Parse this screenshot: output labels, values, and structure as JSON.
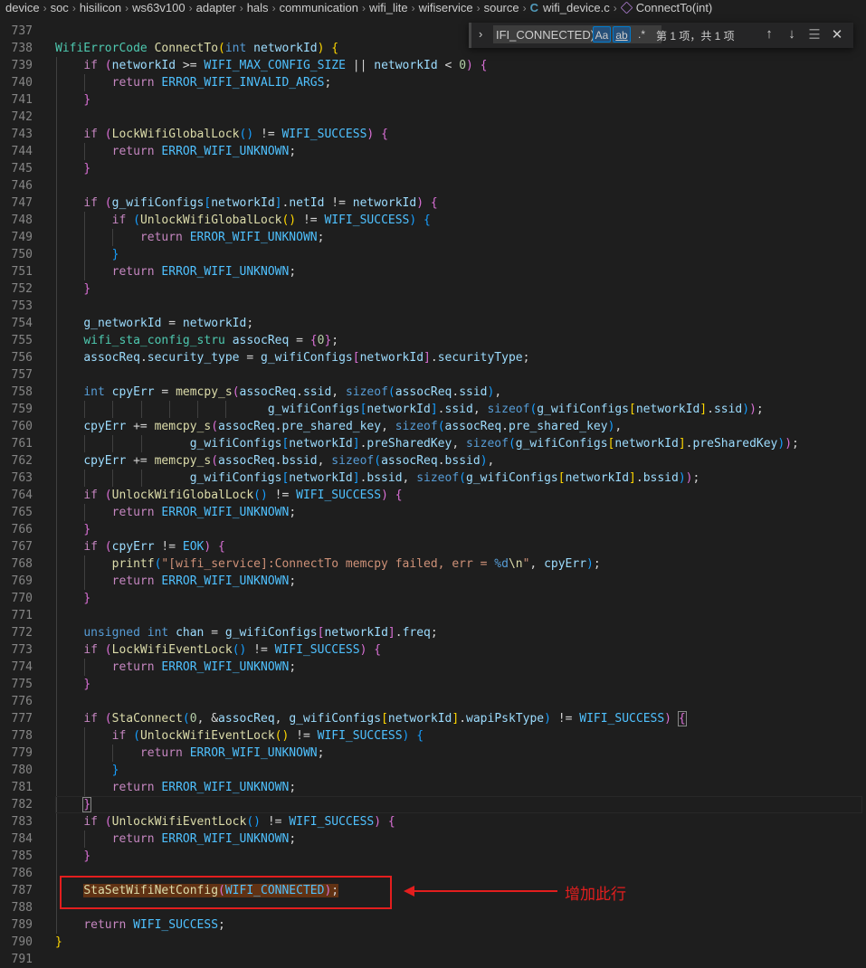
{
  "breadcrumb": {
    "items": [
      "device",
      "soc",
      "hisilicon",
      "ws63v100",
      "adapter",
      "hals",
      "communication",
      "wifi_lite",
      "wifiservice",
      "source"
    ],
    "file": "wifi_device.c",
    "symbol": "ConnectTo(int)"
  },
  "find_widget": {
    "query": "IFI_CONNECTED);",
    "match_case_label": "Aa",
    "whole_word_label": "ab",
    "regex_label": ".*",
    "result_count": "第 1 项，共 1 项"
  },
  "annotation": {
    "text": "增加此行"
  },
  "colors": {
    "annotation": "#e31e1e",
    "background": "#1e1e1e"
  },
  "lines": [
    {
      "n": "737",
      "html": ""
    },
    {
      "n": "738",
      "html": "<span class='ty'>WifiErrorCode</span> <span class='fn'>ConnectTo</span><span class='b1'>(</span><span class='kw'>int</span> <span class='var'>networkId</span><span class='b1'>)</span> <span class='b1'>{</span>"
    },
    {
      "n": "739",
      "html": "    <span class='ctl'>if</span> <span class='b2'>(</span><span class='var'>networkId</span> &gt;= <span class='mac'>WIFI_MAX_CONFIG_SIZE</span> || <span class='var'>networkId</span> &lt; <span class='num'>0</span><span class='b2'>)</span> <span class='b2'>{</span>"
    },
    {
      "n": "740",
      "html": "        <span class='ctl'>return</span> <span class='mac'>ERROR_WIFI_INVALID_ARGS</span>;"
    },
    {
      "n": "741",
      "html": "    <span class='b2'>}</span>"
    },
    {
      "n": "742",
      "html": ""
    },
    {
      "n": "743",
      "html": "    <span class='ctl'>if</span> <span class='b2'>(</span><span class='fn'>LockWifiGlobalLock</span><span class='b3'>()</span> != <span class='mac'>WIFI_SUCCESS</span><span class='b2'>)</span> <span class='b2'>{</span>"
    },
    {
      "n": "744",
      "html": "        <span class='ctl'>return</span> <span class='mac'>ERROR_WIFI_UNKNOWN</span>;"
    },
    {
      "n": "745",
      "html": "    <span class='b2'>}</span>"
    },
    {
      "n": "746",
      "html": ""
    },
    {
      "n": "747",
      "html": "    <span class='ctl'>if</span> <span class='b2'>(</span><span class='var'>g_wifiConfigs</span><span class='b3'>[</span><span class='var'>networkId</span><span class='b3'>]</span>.<span class='var'>netId</span> != <span class='var'>networkId</span><span class='b2'>)</span> <span class='b2'>{</span>"
    },
    {
      "n": "748",
      "html": "        <span class='ctl'>if</span> <span class='b3'>(</span><span class='fn'>UnlockWifiGlobalLock</span><span class='b1'>()</span> != <span class='mac'>WIFI_SUCCESS</span><span class='b3'>)</span> <span class='b3'>{</span>"
    },
    {
      "n": "749",
      "html": "            <span class='ctl'>return</span> <span class='mac'>ERROR_WIFI_UNKNOWN</span>;"
    },
    {
      "n": "750",
      "html": "        <span class='b3'>}</span>"
    },
    {
      "n": "751",
      "html": "        <span class='ctl'>return</span> <span class='mac'>ERROR_WIFI_UNKNOWN</span>;"
    },
    {
      "n": "752",
      "html": "    <span class='b2'>}</span>"
    },
    {
      "n": "753",
      "html": ""
    },
    {
      "n": "754",
      "html": "    <span class='var'>g_networkId</span> = <span class='var'>networkId</span>;"
    },
    {
      "n": "755",
      "html": "    <span class='ty'>wifi_sta_config_stru</span> <span class='var'>assocReq</span> = <span class='b2'>{</span><span class='num'>0</span><span class='b2'>}</span>;"
    },
    {
      "n": "756",
      "html": "    <span class='var'>assocReq</span>.<span class='var'>security_type</span> = <span class='var'>g_wifiConfigs</span><span class='b2'>[</span><span class='var'>networkId</span><span class='b2'>]</span>.<span class='var'>securityType</span>;"
    },
    {
      "n": "757",
      "html": ""
    },
    {
      "n": "758",
      "html": "    <span class='kw'>int</span> <span class='var'>cpyErr</span> = <span class='fn'>memcpy_s</span><span class='b2'>(</span><span class='var'>assocReq</span>.<span class='var'>ssid</span>, <span class='kw'>sizeof</span><span class='b3'>(</span><span class='var'>assocReq</span>.<span class='var'>ssid</span><span class='b3'>)</span>,"
    },
    {
      "n": "759",
      "html": "                              <span class='var'>g_wifiConfigs</span><span class='b3'>[</span><span class='var'>networkId</span><span class='b3'>]</span>.<span class='var'>ssid</span>, <span class='kw'>sizeof</span><span class='b3'>(</span><span class='var'>g_wifiConfigs</span><span class='b1'>[</span><span class='var'>networkId</span><span class='b1'>]</span>.<span class='var'>ssid</span><span class='b3'>)</span><span class='b2'>)</span>;"
    },
    {
      "n": "760",
      "html": "    <span class='var'>cpyErr</span> += <span class='fn'>memcpy_s</span><span class='b2'>(</span><span class='var'>assocReq</span>.<span class='var'>pre_shared_key</span>, <span class='kw'>sizeof</span><span class='b3'>(</span><span class='var'>assocReq</span>.<span class='var'>pre_shared_key</span><span class='b3'>)</span>,"
    },
    {
      "n": "761",
      "html": "                   <span class='var'>g_wifiConfigs</span><span class='b3'>[</span><span class='var'>networkId</span><span class='b3'>]</span>.<span class='var'>preSharedKey</span>, <span class='kw'>sizeof</span><span class='b3'>(</span><span class='var'>g_wifiConfigs</span><span class='b1'>[</span><span class='var'>networkId</span><span class='b1'>]</span>.<span class='var'>preSharedKey</span><span class='b3'>)</span><span class='b2'>)</span>;"
    },
    {
      "n": "762",
      "html": "    <span class='var'>cpyErr</span> += <span class='fn'>memcpy_s</span><span class='b2'>(</span><span class='var'>assocReq</span>.<span class='var'>bssid</span>, <span class='kw'>sizeof</span><span class='b3'>(</span><span class='var'>assocReq</span>.<span class='var'>bssid</span><span class='b3'>)</span>,"
    },
    {
      "n": "763",
      "html": "                   <span class='var'>g_wifiConfigs</span><span class='b3'>[</span><span class='var'>networkId</span><span class='b3'>]</span>.<span class='var'>bssid</span>, <span class='kw'>sizeof</span><span class='b3'>(</span><span class='var'>g_wifiConfigs</span><span class='b1'>[</span><span class='var'>networkId</span><span class='b1'>]</span>.<span class='var'>bssid</span><span class='b3'>)</span><span class='b2'>)</span>;"
    },
    {
      "n": "764",
      "html": "    <span class='ctl'>if</span> <span class='b2'>(</span><span class='fn'>UnlockWifiGlobalLock</span><span class='b3'>()</span> != <span class='mac'>WIFI_SUCCESS</span><span class='b2'>)</span> <span class='b2'>{</span>"
    },
    {
      "n": "765",
      "html": "        <span class='ctl'>return</span> <span class='mac'>ERROR_WIFI_UNKNOWN</span>;"
    },
    {
      "n": "766",
      "html": "    <span class='b2'>}</span>"
    },
    {
      "n": "767",
      "html": "    <span class='ctl'>if</span> <span class='b2'>(</span><span class='var'>cpyErr</span> != <span class='mac'>EOK</span><span class='b2'>)</span> <span class='b2'>{</span>"
    },
    {
      "n": "768",
      "html": "        <span class='fn'>printf</span><span class='b3'>(</span><span class='str'>\"[wifi_service]:ConnectTo memcpy failed, err = </span><span class='kw'>%d</span><span class='fn'>\\n</span><span class='str'>\"</span>, <span class='var'>cpyErr</span><span class='b3'>)</span>;"
    },
    {
      "n": "769",
      "html": "        <span class='ctl'>return</span> <span class='mac'>ERROR_WIFI_UNKNOWN</span>;"
    },
    {
      "n": "770",
      "html": "    <span class='b2'>}</span>"
    },
    {
      "n": "771",
      "html": ""
    },
    {
      "n": "772",
      "html": "    <span class='kw'>unsigned</span> <span class='kw'>int</span> <span class='var'>chan</span> = <span class='var'>g_wifiConfigs</span><span class='b2'>[</span><span class='var'>networkId</span><span class='b2'>]</span>.<span class='var'>freq</span>;"
    },
    {
      "n": "773",
      "html": "    <span class='ctl'>if</span> <span class='b2'>(</span><span class='fn'>LockWifiEventLock</span><span class='b3'>()</span> != <span class='mac'>WIFI_SUCCESS</span><span class='b2'>)</span> <span class='b2'>{</span>"
    },
    {
      "n": "774",
      "html": "        <span class='ctl'>return</span> <span class='mac'>ERROR_WIFI_UNKNOWN</span>;"
    },
    {
      "n": "775",
      "html": "    <span class='b2'>}</span>"
    },
    {
      "n": "776",
      "html": ""
    },
    {
      "n": "777",
      "html": "    <span class='ctl'>if</span> <span class='b2'>(</span><span class='fn'>StaConnect</span><span class='b3'>(</span><span class='num'>0</span>, &amp;<span class='var'>assocReq</span>, <span class='var'>g_wifiConfigs</span><span class='b1'>[</span><span class='var'>networkId</span><span class='b1'>]</span>.<span class='var'>wapiPskType</span><span class='b3'>)</span> != <span class='mac'>WIFI_SUCCESS</span><span class='b2'>)</span> <span class='b2' style='outline:1px solid #888'>{</span>"
    },
    {
      "n": "778",
      "html": "        <span class='ctl'>if</span> <span class='b3'>(</span><span class='fn'>UnlockWifiEventLock</span><span class='b1'>()</span> != <span class='mac'>WIFI_SUCCESS</span><span class='b3'>)</span> <span class='b3'>{</span>"
    },
    {
      "n": "779",
      "html": "            <span class='ctl'>return</span> <span class='mac'>ERROR_WIFI_UNKNOWN</span>;"
    },
    {
      "n": "780",
      "html": "        <span class='b3'>}</span>"
    },
    {
      "n": "781",
      "html": "        <span class='ctl'>return</span> <span class='mac'>ERROR_WIFI_UNKNOWN</span>;"
    },
    {
      "n": "782",
      "html": "    <span class='b2' style='outline:1px solid #888'>}</span>"
    },
    {
      "n": "783",
      "html": "    <span class='ctl'>if</span> <span class='b2'>(</span><span class='fn'>UnlockWifiEventLock</span><span class='b3'>()</span> != <span class='mac'>WIFI_SUCCESS</span><span class='b2'>)</span> <span class='b2'>{</span>"
    },
    {
      "n": "784",
      "html": "        <span class='ctl'>return</span> <span class='mac'>ERROR_WIFI_UNKNOWN</span>;"
    },
    {
      "n": "785",
      "html": "    <span class='b2'>}</span>"
    },
    {
      "n": "786",
      "html": ""
    },
    {
      "n": "787",
      "html": "    <span class='hl'><span class='fn'>StaSetWifiNetConfig</span><span class='b2'>(</span><span class='mac'>WIFI_CONNECTED</span><span class='b2'>)</span>;</span>"
    },
    {
      "n": "788",
      "html": ""
    },
    {
      "n": "789",
      "html": "    <span class='ctl'>return</span> <span class='mac'>WIFI_SUCCESS</span>;"
    },
    {
      "n": "790",
      "html": "<span class='b1'>}</span>"
    },
    {
      "n": "791",
      "html": ""
    }
  ]
}
